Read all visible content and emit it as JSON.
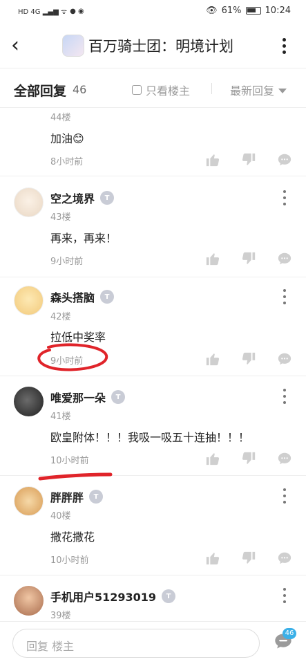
{
  "status": {
    "left_icons": "HD 4G ▂▄▆ ᯤ",
    "battery": "61%",
    "time": "10:24"
  },
  "header": {
    "title": "百万骑士团：明境计划"
  },
  "filter": {
    "all_replies": "全部回复",
    "count": "46",
    "only_host": "只看楼主",
    "sort": "最新回复"
  },
  "posts": [
    {
      "name": "",
      "floor": "44楼",
      "content": "加油😊",
      "time": "8小时前"
    },
    {
      "name": "空之境界",
      "floor": "43楼",
      "content": "再来，再来！",
      "time": "9小时前"
    },
    {
      "name": "森头搭脑",
      "floor": "42楼",
      "content": "拉低中奖率",
      "time": "9小时前"
    },
    {
      "name": "唯爱那一朵",
      "floor": "41楼",
      "content": "欧皇附体！！！我吸一吸五十连抽！！！",
      "time": "10小时前"
    },
    {
      "name": "胖胖胖",
      "floor": "40楼",
      "content": "撒花撒花",
      "time": "10小时前"
    },
    {
      "name": "手机用户51293019",
      "floor": "39楼",
      "content": "",
      "time": ""
    }
  ],
  "bottom": {
    "placeholder": "回复  楼主",
    "badge": "46"
  },
  "colors": {
    "accent_badge": "#3bb0e8",
    "annotation_red": "#e0242a",
    "level_badge": "#c9ccd6"
  }
}
